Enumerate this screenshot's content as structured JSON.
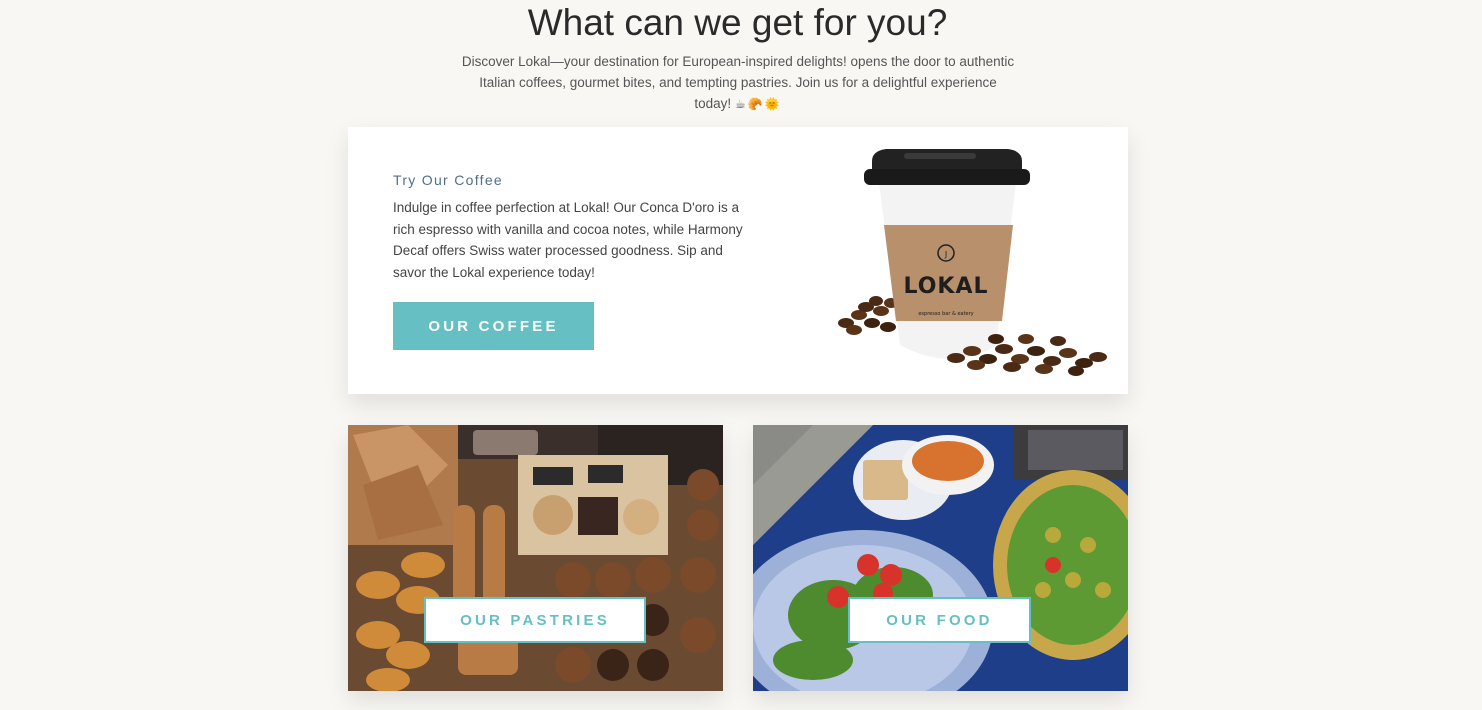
{
  "section": {
    "heading": "What can we get for you?",
    "intro": "Discover Lokal—your destination for European-inspired delights! opens the door to authentic Italian coffees, gourmet bites, and tempting pastries. Join us for a delightful experience today!",
    "intro_emojis": "☕🥐🌞"
  },
  "coffee_card": {
    "eyebrow": "Try Our Coffee",
    "body": "Indulge in coffee perfection at Lokal! Our Conca D'oro is a rich espresso with vanilla and cocoa notes, while Harmony Decaf offers Swiss water processed goodness. Sip and savor the Lokal experience today!",
    "button_label": "OUR COFFEE",
    "cup_brand": "LOKAL",
    "cup_tagline": "espresso bar & eatery"
  },
  "pastries_card": {
    "button_label": "OUR PASTRIES"
  },
  "food_card": {
    "button_label": "OUR FOOD"
  },
  "colors": {
    "accent": "#66bfc3",
    "eyebrow": "#4f6f8c",
    "page_bg": "#f8f7f4"
  }
}
